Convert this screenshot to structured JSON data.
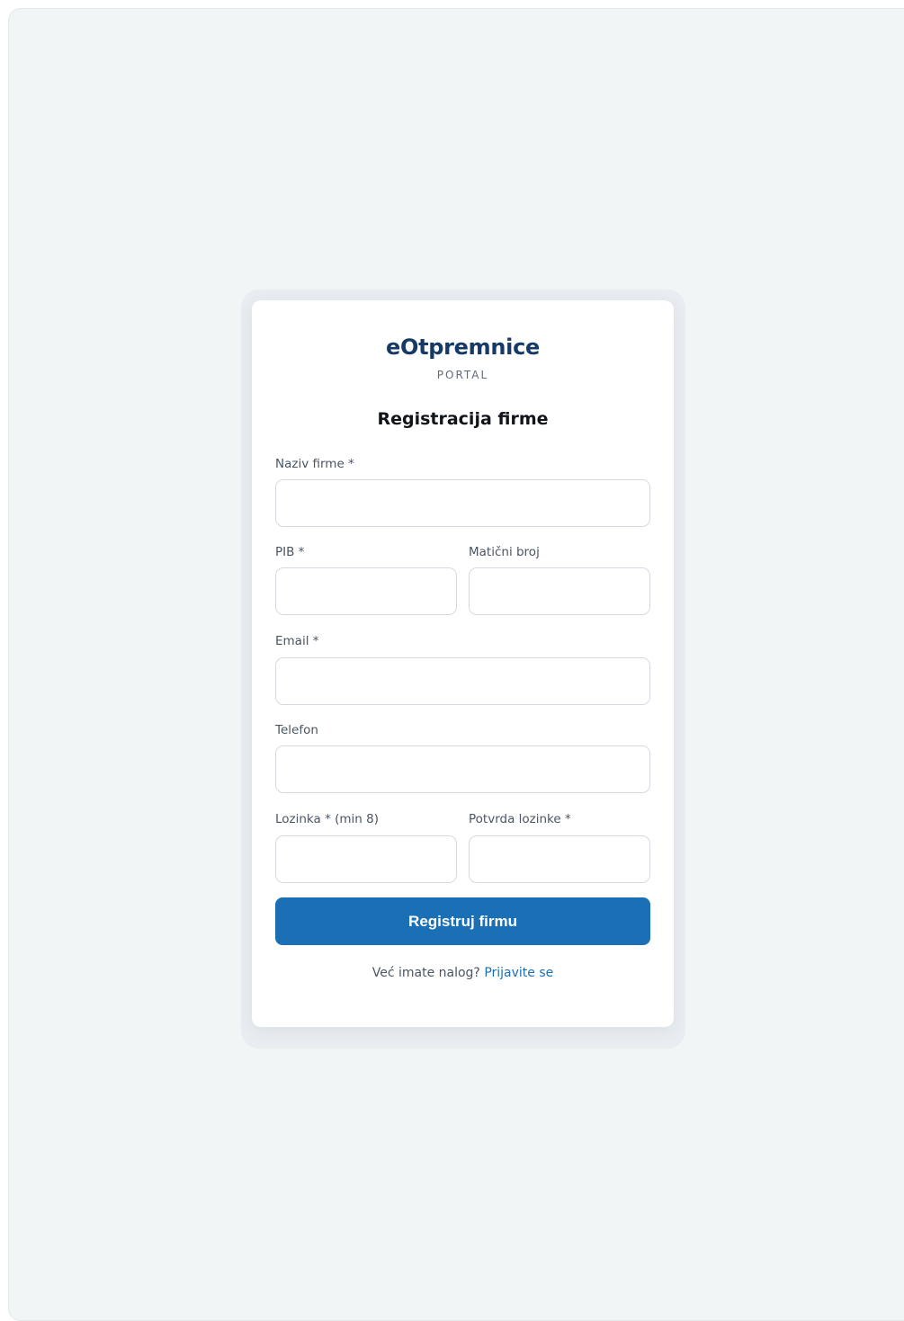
{
  "brand": {
    "name": "eOtpremnice",
    "subtitle": "PORTAL"
  },
  "form": {
    "title": "Registracija firme",
    "fields": {
      "company_name": {
        "label": "Naziv firme *",
        "value": ""
      },
      "pib": {
        "label": "PIB *",
        "value": ""
      },
      "registration_number": {
        "label": "Matični broj",
        "value": ""
      },
      "email": {
        "label": "Email *",
        "value": ""
      },
      "phone": {
        "label": "Telefon",
        "value": ""
      },
      "password": {
        "label": "Lozinka * (min 8)",
        "value": ""
      },
      "password_confirm": {
        "label": "Potvrda lozinke *",
        "value": ""
      }
    },
    "submit_label": "Registruj firmu"
  },
  "footer": {
    "prompt": "Već imate nalog?",
    "login_link": "Prijavite se"
  },
  "colors": {
    "brand": "#163a66",
    "accent": "#1b6fb5",
    "background": "#f1f5f6"
  }
}
